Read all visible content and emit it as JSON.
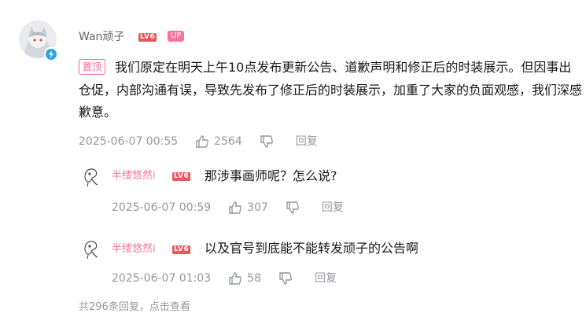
{
  "comment": {
    "author": "Wan顽子",
    "level_badge": "LV6",
    "up_badge": "UP",
    "pin_label": "置顶",
    "content": "我们原定在明天上午10点发布更新公告、道歉声明和修正后的时装展示。但因事出仓促，内部沟通有误，导致先发布了修正后的时装展示，加重了大家的负面观感，我们深感歉意。",
    "time": "2025-06-07 00:55",
    "likes": "2564",
    "reply_label": "回复"
  },
  "replies": [
    {
      "author": "半缕悠然i",
      "level_badge": "LV6",
      "text": "那涉事画师呢？怎么说?",
      "time": "2025-06-07 00:59",
      "likes": "307",
      "reply_label": "回复"
    },
    {
      "author": "半缕悠然i",
      "level_badge": "LV6",
      "text": "以及官号到底能不能转发顽子的公告啊",
      "time": "2025-06-07 01:03",
      "likes": "58",
      "reply_label": "回复"
    }
  ],
  "more_replies": "共296条回复，点击查看",
  "colors": {
    "pink": "#fb7299",
    "level_red": "#e8565c",
    "muted": "#9499a0",
    "text": "#18191c"
  },
  "icons": [
    "avatar",
    "verified-bolt-icon",
    "thumb-up-icon",
    "thumb-down-icon"
  ]
}
